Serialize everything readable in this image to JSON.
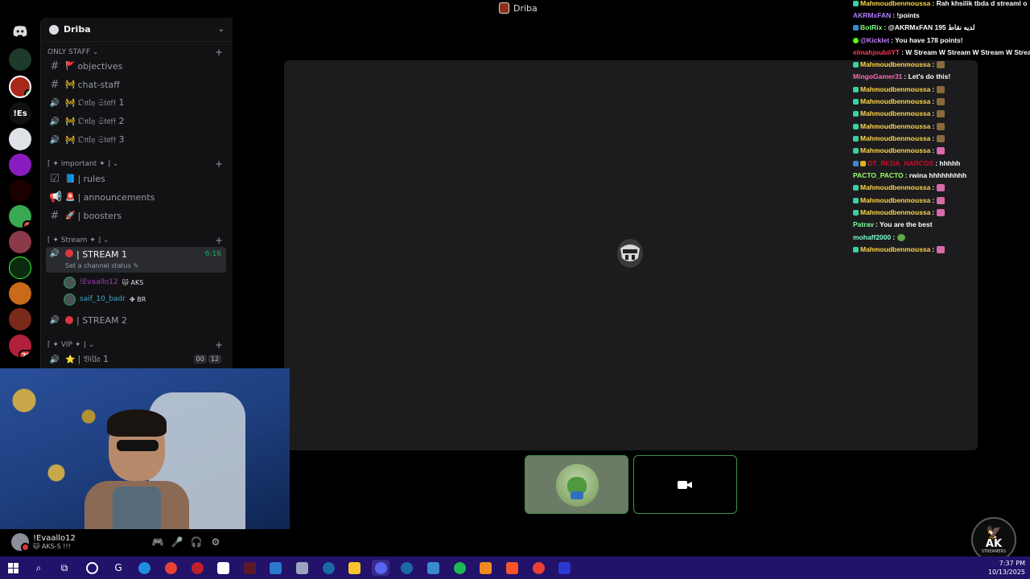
{
  "window": {
    "title": "Driba"
  },
  "server": {
    "name": "Driba"
  },
  "categories": [
    {
      "label": "ONLY STAFF ⌄"
    },
    {
      "label": "⌈ ✦ important ✦ ⌋ ⌄"
    },
    {
      "label": "⌈ ✦ Stream ✦ ⌋ ⌄"
    },
    {
      "label": "⌈ ✦ VIP ✦ ⌋ ⌄"
    }
  ],
  "channels": [
    {
      "emoji": "🚩",
      "name": "objectives"
    },
    {
      "emoji": "🚧",
      "name": "chat-staff"
    },
    {
      "emoji": "🚧",
      "name": "𝔒𝔫𝔩𝔶 𝔖𝔱𝔞𝔣𝔣 1"
    },
    {
      "emoji": "🚧",
      "name": "𝔒𝔫𝔩𝔶 𝔖𝔱𝔞𝔣𝔣 2"
    },
    {
      "emoji": "🚧",
      "name": "𝔒𝔫𝔩𝔶 𝔖𝔱𝔞𝔣𝔣 3"
    },
    {
      "emoji": "📘",
      "name": "| rules"
    },
    {
      "emoji": "🚨",
      "name": "| announcements"
    },
    {
      "emoji": "🚀",
      "name": "| boosters"
    },
    {
      "emoji": "",
      "name": "| STREAM 1",
      "time": "6:16",
      "status": "Set a channel status ✎"
    },
    {
      "emoji": "",
      "name": "| STREAM 2"
    },
    {
      "emoji": "⭐",
      "name": "| 𝔙𝔦𝔩𝔩𝔞 1",
      "counts": [
        "00",
        "12"
      ]
    }
  ],
  "voice_users": [
    {
      "name": "!Evaallo12",
      "tag": "AKS",
      "color": "#a23ab8"
    },
    {
      "name": "saif_10_badr",
      "tag": "BR",
      "color": "#3fa8c8"
    }
  ],
  "servers": [
    {
      "label": ""
    },
    {
      "label": ""
    },
    {
      "label": ""
    },
    {
      "label": "!Es"
    },
    {
      "label": ""
    },
    {
      "label": ""
    },
    {
      "label": ""
    },
    {
      "label": ""
    },
    {
      "label": ""
    },
    {
      "label": ""
    },
    {
      "label": ""
    },
    {
      "label": ""
    },
    {
      "label": ""
    }
  ],
  "server_badges": {
    "s2": "",
    "s9": "1",
    "s13": "70"
  },
  "chat": [
    {
      "user": "Mahmoudbenmoussa",
      "color": "#ffd54a",
      "text": ": Rah khsilik tbda d streaml o",
      "badge": true
    },
    {
      "user": "AKRMxFAN",
      "color": "#b07cff",
      "text": ": !points",
      "badge": false
    },
    {
      "user": "BotRix",
      "color": "#7dff7d",
      "text": ": @AKRMxFAN لديه نقاط 195",
      "badge": true
    },
    {
      "user": "@Kicklet",
      "color": "#c27dff",
      "text": ": You have 178 points!",
      "badge": true
    },
    {
      "user": "elmahjoubiiYT",
      "color": "#ff3d5a",
      "text": ": W Stream W Stream W Stream W Stream",
      "badge": false
    },
    {
      "user": "Mahmoudbenmoussa",
      "color": "#ffd54a",
      "text": ":",
      "badge": true,
      "emote": "#8a6a3a"
    },
    {
      "user": "MingoGamer31",
      "color": "#ff6bb5",
      "text": ": Let's do this!",
      "badge": false
    },
    {
      "user": "Mahmoudbenmoussa",
      "color": "#ffd54a",
      "text": ":",
      "badge": true,
      "emote": "#8a6a3a"
    },
    {
      "user": "Mahmoudbenmoussa",
      "color": "#ffd54a",
      "text": ":",
      "badge": true,
      "emote": "#8a6a3a"
    },
    {
      "user": "Mahmoudbenmoussa",
      "color": "#ffd54a",
      "text": ":",
      "badge": true,
      "emote": "#8a6a3a"
    },
    {
      "user": "Mahmoudbenmoussa",
      "color": "#ffd54a",
      "text": ":",
      "badge": true,
      "emote": "#8a6a3a"
    },
    {
      "user": "Mahmoudbenmoussa",
      "color": "#ffd54a",
      "text": ":",
      "badge": true,
      "emote": "#8a6a3a"
    },
    {
      "user": "Mahmoudbenmoussa",
      "color": "#ffd54a",
      "text": ":",
      "badge": true,
      "emote": "#d86aa8"
    },
    {
      "user": "OT_REDA_NARCOS",
      "color": "#c8102e",
      "text": ": hhhhh",
      "badge": true
    },
    {
      "user": "PACTO_PACTO",
      "color": "#9dff6a",
      "text": ": rwina hhhhhhhhh",
      "badge": false
    },
    {
      "user": "Mahmoudbenmoussa",
      "color": "#ffd54a",
      "text": ":",
      "badge": true,
      "emote": "#d86aa8"
    },
    {
      "user": "Mahmoudbenmoussa",
      "color": "#ffd54a",
      "text": ":",
      "badge": true,
      "emote": "#d86aa8"
    },
    {
      "user": "Mahmoudbenmoussa",
      "color": "#ffd54a",
      "text": ":",
      "badge": true,
      "emote": "#d86aa8"
    },
    {
      "user": "Patrav",
      "color": "#7dff9d",
      "text": ": You are the best",
      "badge": false
    },
    {
      "user": "mohaff2000",
      "color": "#7dffcf",
      "text": ":",
      "badge": false,
      "emote": "#5aaa4a"
    },
    {
      "user": "Mahmoudbenmoussa",
      "color": "#ffd54a",
      "text": ":",
      "badge": true,
      "emote": "#d86aa8"
    }
  ],
  "user_panel": {
    "name": "!Evaallo12",
    "status": "🐱 AKS-S !!!"
  },
  "logo": {
    "title": "AK",
    "subtitle": "STREAMERS"
  },
  "tray": {
    "time": "7:37 PM",
    "date": "10/13/2025"
  },
  "colors": {
    "accent_green": "#23a55a",
    "live_red": "#da373c",
    "taskbar": "#22126a"
  }
}
